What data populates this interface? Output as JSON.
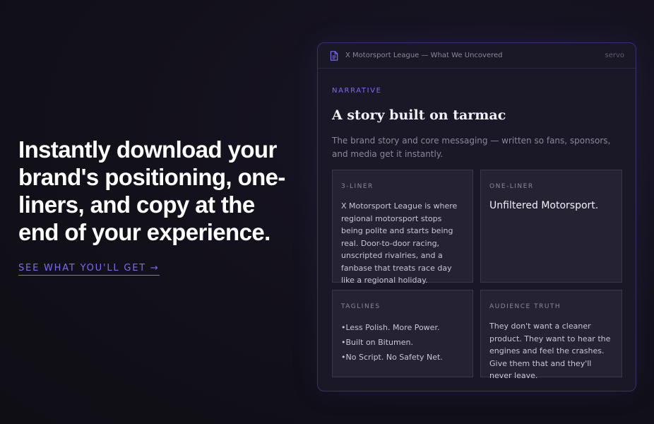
{
  "hero": {
    "title": "Instantly download your brand's positioning, one-liners, and copy at the end of your experience.",
    "cta_label": "SEE WHAT YOU'LL GET →"
  },
  "panel": {
    "title": "X Motorsport League — What We Uncovered",
    "tag": "servo",
    "eyebrow": "NARRATIVE",
    "section_title": "A story built on tarmac",
    "section_desc": "The brand story and core messaging — written so fans, sponsors, and media get it instantly.",
    "cards": {
      "three_liner": {
        "label": "3-LINER",
        "text": "X Motorsport League is where regional motorsport stops being polite and starts being real. Door-to-door racing, unscripted rivalries, and a fanbase that treats race day like a regional holiday."
      },
      "one_liner": {
        "label": "ONE-LINER",
        "text": "Unfiltered Motorsport."
      },
      "taglines": {
        "label": "TAGLINES",
        "items": [
          "Less Polish. More Power.",
          "Built on Bitumen.",
          "No Script. No Safety Net."
        ]
      },
      "audience_truth": {
        "label": "AUDIENCE TRUTH",
        "text": "They don't want a cleaner product. They want to hear the engines and feel the crashes. Give them that and they'll never leave."
      }
    }
  },
  "colors": {
    "accent": "#7b6cf6",
    "background": "#121019",
    "panel": "#1a1826",
    "card": "#242233"
  },
  "icons": {
    "panel_header": "document-icon"
  }
}
